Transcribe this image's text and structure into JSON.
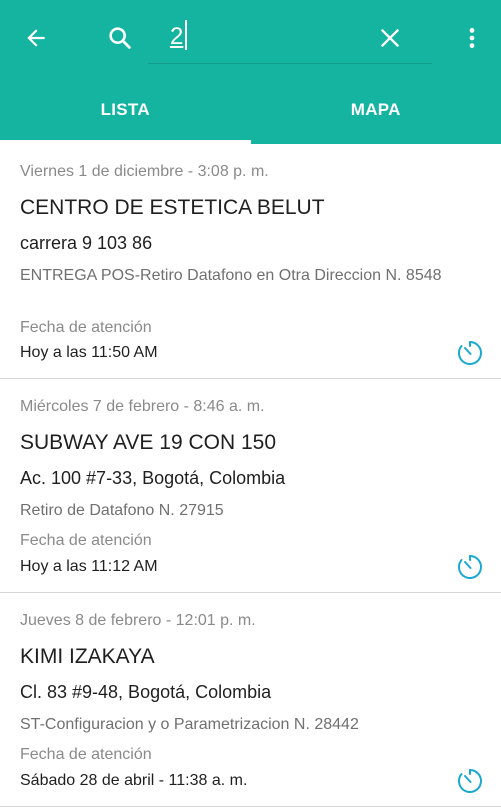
{
  "search": {
    "value": "2"
  },
  "tabs": [
    {
      "label": "LISTA",
      "active": true
    },
    {
      "label": "MAPA",
      "active": false
    }
  ],
  "colors": {
    "primary": "#14b4a0",
    "accent": "#1aa9d1"
  },
  "items": [
    {
      "date": "Viernes 1 de diciembre - 3:08 p. m.",
      "name": "CENTRO DE ESTETICA BELUT",
      "address": "carrera 9 103 86",
      "service": "ENTREGA POS-Retiro Datafono en Otra Direccion N. 8548",
      "attention_label": "Fecha de atención",
      "attention_value": "Hoy a las 11:50 AM"
    },
    {
      "date": "Miércoles 7 de febrero - 8:46 a. m.",
      "name": "SUBWAY AVE 19 CON 150",
      "address": "Ac. 100 #7-33, Bogotá, Colombia",
      "service": "Retiro de Datafono N. 27915",
      "attention_label": "Fecha de atención",
      "attention_value": "Hoy a las 11:12 AM"
    },
    {
      "date": "Jueves 8 de febrero - 12:01 p. m.",
      "name": "KIMI IZAKAYA",
      "address": "Cl. 83 #9-48, Bogotá, Colombia",
      "service": "ST-Configuracion y o Parametrizacion N. 28442",
      "attention_label": "Fecha de atención",
      "attention_value": "Sábado 28 de abril - 11:38 a. m."
    }
  ]
}
